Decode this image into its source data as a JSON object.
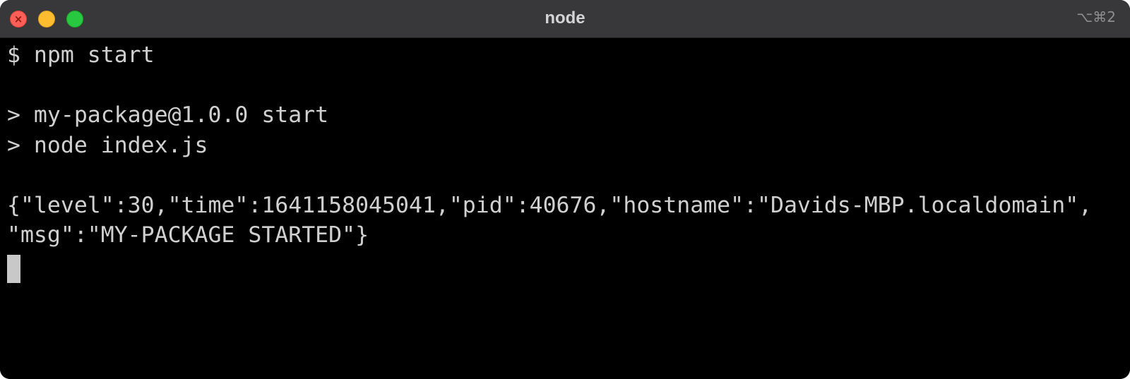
{
  "window": {
    "title": "node",
    "shortcut": "⌥⌘2",
    "traffic_lights": {
      "close_icon": "close-icon",
      "minimize_icon": "minimize-icon",
      "maximize_icon": "maximize-icon",
      "close_color": "#ff5f57",
      "minimize_color": "#febc2e",
      "maximize_color": "#28c840"
    }
  },
  "terminal": {
    "background": "#000000",
    "foreground": "#d0d0d0",
    "lines": [
      "$ npm start",
      "",
      "> my-package@1.0.0 start",
      "> node index.js",
      "",
      "{\"level\":30,\"time\":1641158045041,\"pid\":40676,\"hostname\":\"Davids-MBP.localdomain\",",
      "\"msg\":\"MY-PACKAGE STARTED\"}"
    ]
  }
}
